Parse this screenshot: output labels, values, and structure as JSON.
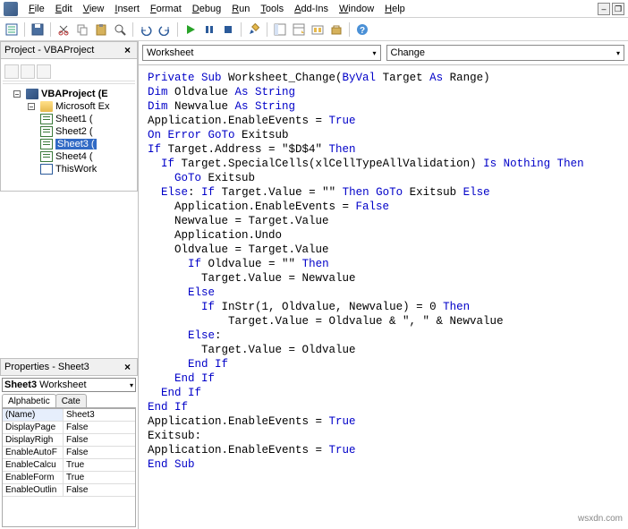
{
  "menus": [
    "File",
    "Edit",
    "View",
    "Insert",
    "Format",
    "Debug",
    "Run",
    "Tools",
    "Add-Ins",
    "Window",
    "Help"
  ],
  "project_panel": {
    "title": "Project - VBAProject",
    "root": "VBAProject (E",
    "folder": "Microsoft Ex",
    "items": [
      "Sheet1 (",
      "Sheet2 (",
      "Sheet3 (",
      "Sheet4 ("
    ],
    "wb": "ThisWork",
    "selected_index": 2
  },
  "properties_panel": {
    "title": "Properties - Sheet3",
    "object": "Sheet3",
    "object_type": "Worksheet",
    "tabs": [
      "Alphabetic",
      "Cate"
    ],
    "rows": [
      {
        "k": "(Name)",
        "v": "Sheet3"
      },
      {
        "k": "DisplayPage",
        "v": "False"
      },
      {
        "k": "DisplayRigh",
        "v": "False"
      },
      {
        "k": "EnableAutoF",
        "v": "False"
      },
      {
        "k": "EnableCalcu",
        "v": "True"
      },
      {
        "k": "EnableForm",
        "v": "True"
      },
      {
        "k": "EnableOutlin",
        "v": "False"
      }
    ]
  },
  "code_pane": {
    "object_combo": "Worksheet",
    "proc_combo": "Change",
    "code_tokens": [
      [
        [
          "k",
          "Private Sub"
        ],
        [
          "",
          " Worksheet_Change("
        ],
        [
          "k",
          "ByVal"
        ],
        [
          "",
          " Target "
        ],
        [
          "k",
          "As"
        ],
        [
          "",
          " Range)"
        ]
      ],
      [
        [
          "k",
          "Dim"
        ],
        [
          "",
          " Oldvalue "
        ],
        [
          "k",
          "As String"
        ]
      ],
      [
        [
          "k",
          "Dim"
        ],
        [
          "",
          " Newvalue "
        ],
        [
          "k",
          "As String"
        ]
      ],
      [
        [
          "",
          "Application.EnableEvents = "
        ],
        [
          "k",
          "True"
        ]
      ],
      [
        [
          "k",
          "On Error GoTo"
        ],
        [
          "",
          " Exitsub"
        ]
      ],
      [
        [
          "k",
          "If"
        ],
        [
          "",
          " Target.Address = \"$D$4\" "
        ],
        [
          "k",
          "Then"
        ]
      ],
      [
        [
          "",
          "  "
        ],
        [
          "k",
          "If"
        ],
        [
          "",
          " Target.SpecialCells(xlCellTypeAllValidation) "
        ],
        [
          "k",
          "Is Nothing Then"
        ]
      ],
      [
        [
          "",
          "    "
        ],
        [
          "k",
          "GoTo"
        ],
        [
          "",
          " Exitsub"
        ]
      ],
      [
        [
          "",
          "  "
        ],
        [
          "k",
          "Else"
        ],
        [
          "",
          ": "
        ],
        [
          "k",
          "If"
        ],
        [
          "",
          " Target.Value = \"\" "
        ],
        [
          "k",
          "Then GoTo"
        ],
        [
          "",
          " Exitsub "
        ],
        [
          "k",
          "Else"
        ]
      ],
      [
        [
          "",
          "    Application.EnableEvents = "
        ],
        [
          "k",
          "False"
        ]
      ],
      [
        [
          "",
          "    Newvalue = Target.Value"
        ]
      ],
      [
        [
          "",
          "    Application.Undo"
        ]
      ],
      [
        [
          "",
          "    Oldvalue = Target.Value"
        ]
      ],
      [
        [
          "",
          "      "
        ],
        [
          "k",
          "If"
        ],
        [
          "",
          " Oldvalue = \"\" "
        ],
        [
          "k",
          "Then"
        ]
      ],
      [
        [
          "",
          "        Target.Value = Newvalue"
        ]
      ],
      [
        [
          "",
          "      "
        ],
        [
          "k",
          "Else"
        ]
      ],
      [
        [
          "",
          "        "
        ],
        [
          "k",
          "If"
        ],
        [
          "",
          " InStr(1, Oldvalue, Newvalue) = 0 "
        ],
        [
          "k",
          "Then"
        ]
      ],
      [
        [
          "",
          "            Target.Value = Oldvalue & \", \" & Newvalue"
        ]
      ],
      [
        [
          "",
          "      "
        ],
        [
          "k",
          "Else"
        ],
        [
          "",
          ":"
        ]
      ],
      [
        [
          "",
          "        Target.Value = Oldvalue"
        ]
      ],
      [
        [
          "",
          "      "
        ],
        [
          "k",
          "End If"
        ]
      ],
      [
        [
          "",
          "    "
        ],
        [
          "k",
          "End If"
        ]
      ],
      [
        [
          "",
          "  "
        ],
        [
          "k",
          "End If"
        ]
      ],
      [
        [
          "k",
          "End If"
        ]
      ],
      [
        [
          "",
          "Application.EnableEvents = "
        ],
        [
          "k",
          "True"
        ]
      ],
      [
        [
          "",
          "Exitsub:"
        ]
      ],
      [
        [
          "",
          "Application.EnableEvents = "
        ],
        [
          "k",
          "True"
        ]
      ],
      [
        [
          "k",
          "End Sub"
        ]
      ]
    ]
  },
  "watermark": "wsxdn.com"
}
